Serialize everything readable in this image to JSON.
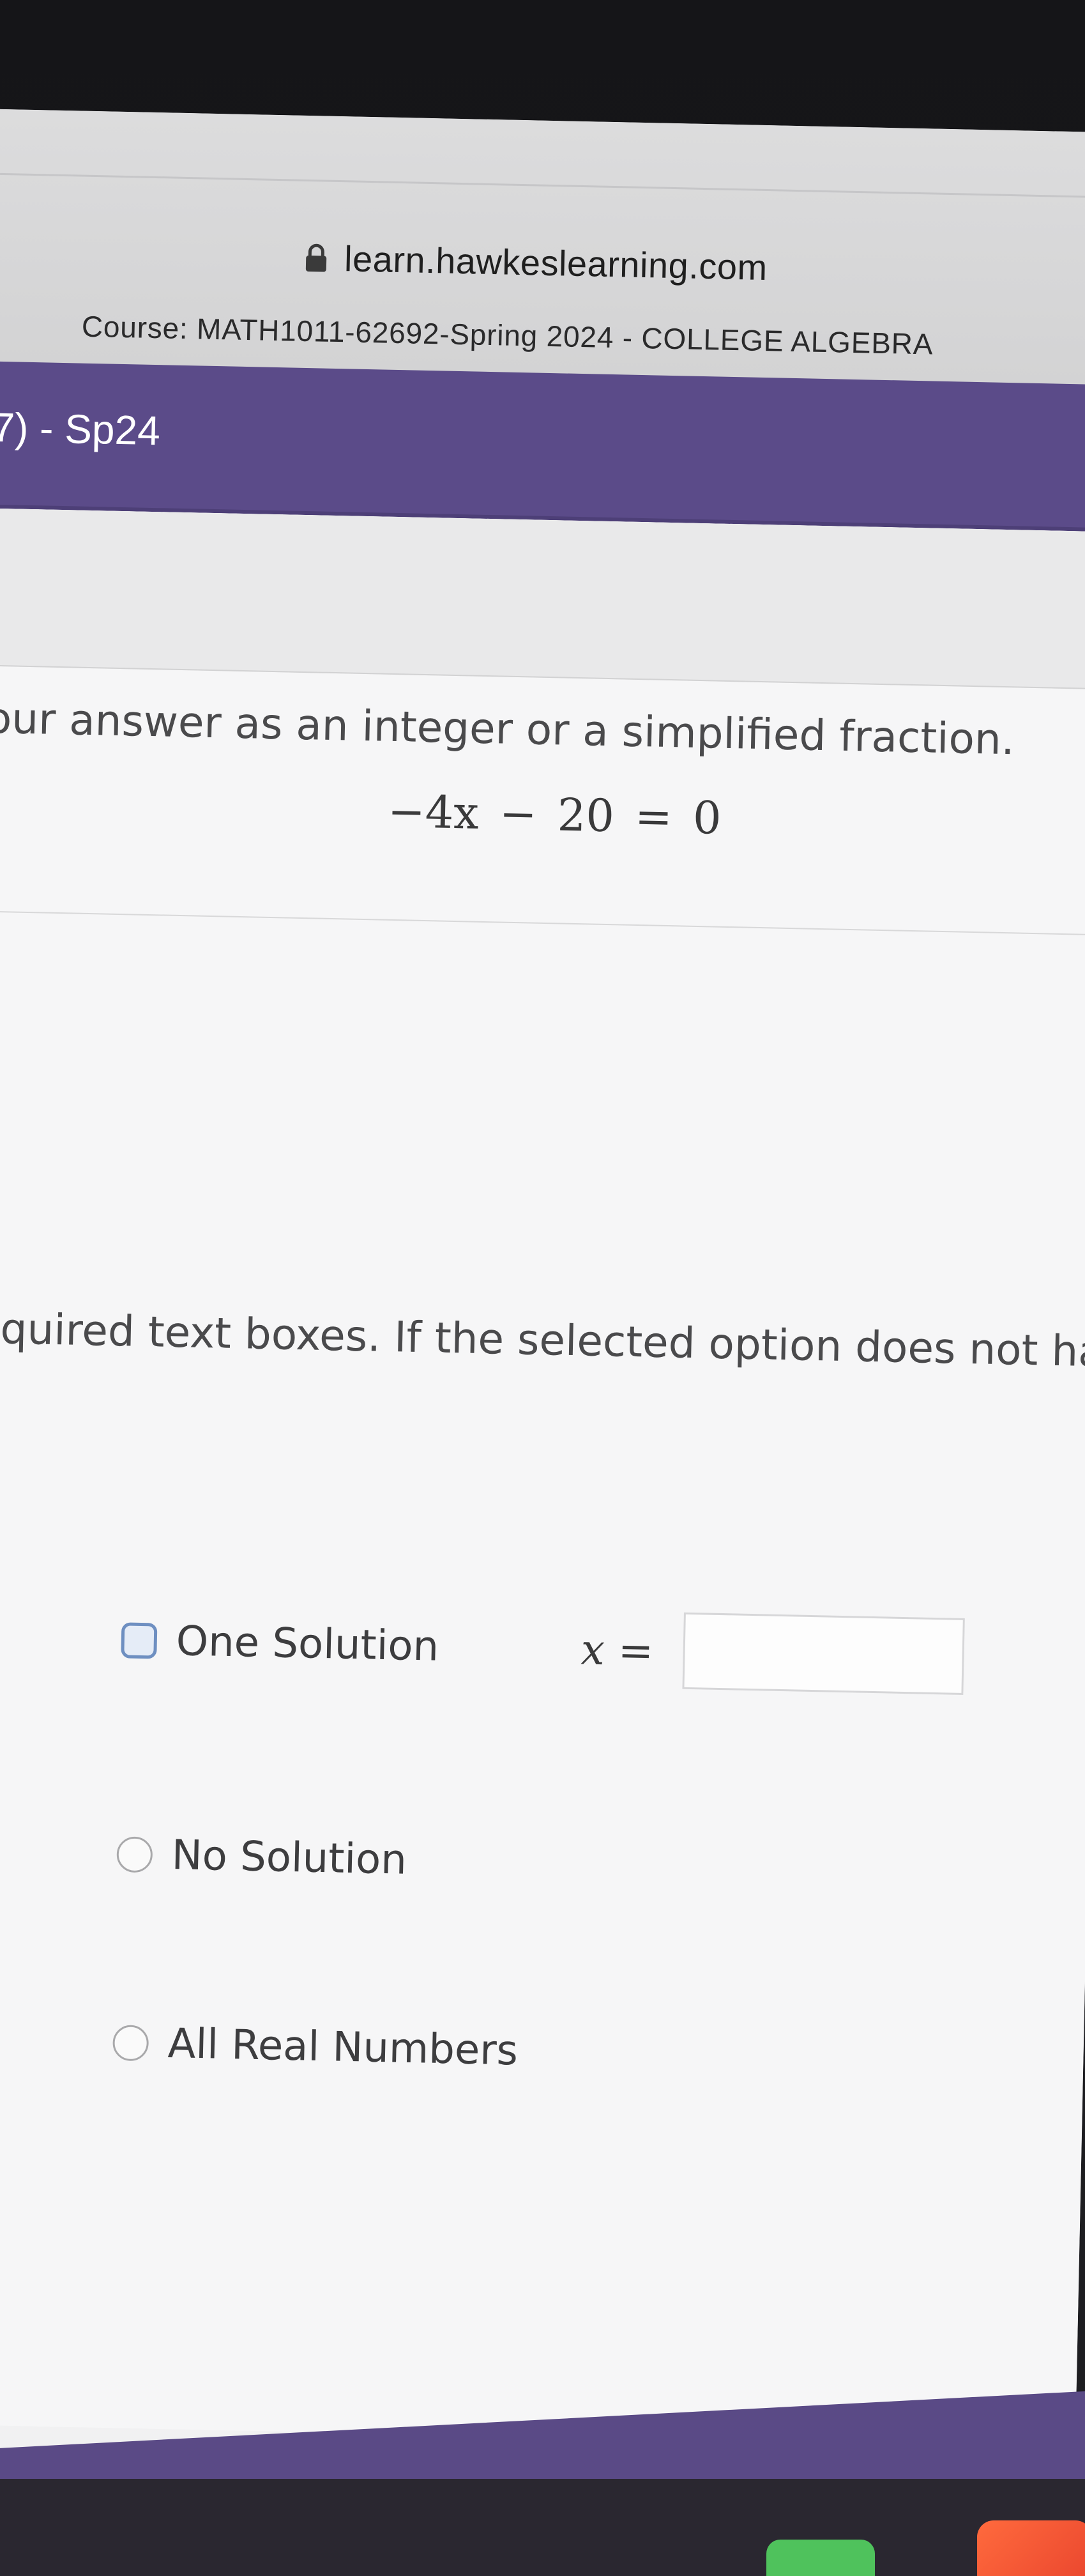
{
  "browser": {
    "url": "learn.hawkeslearning.com"
  },
  "course": {
    "label": "Course: MATH1011-62692-Spring 2024 - COLLEGE ALGEBRA"
  },
  "assignment": {
    "title": "7) - Sp24"
  },
  "question": {
    "instruction": "our answer as an integer or a simplified fraction.",
    "equation": "−4x − 20 = 0",
    "select_instruction": "equired text boxes. If the selected option does not have ar"
  },
  "options": [
    {
      "label": "One Solution",
      "selected": true
    },
    {
      "label": "No Solution",
      "selected": false
    },
    {
      "label": "All Real Numbers",
      "selected": false
    }
  ],
  "answer": {
    "variable_label": "x =",
    "value": "",
    "placeholder": ""
  },
  "colors": {
    "brand_purple": "#5b4b89",
    "selected_option": "#6e8fc1"
  },
  "icons": {
    "lock": "lock-icon"
  }
}
